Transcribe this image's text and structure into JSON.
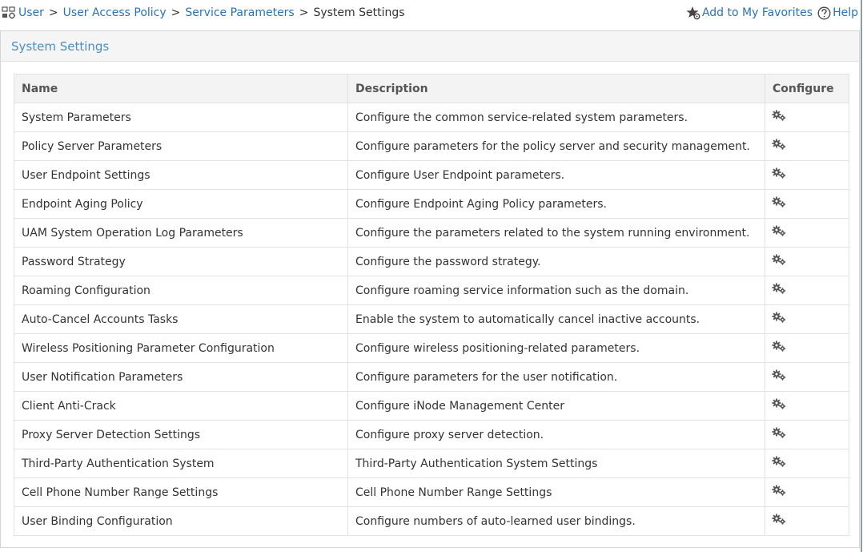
{
  "breadcrumb": {
    "items": [
      {
        "label": "User"
      },
      {
        "label": "User Access Policy"
      },
      {
        "label": "Service Parameters"
      }
    ],
    "separator": ">",
    "current": "System Settings"
  },
  "actions": {
    "favorites": "Add to My Favorites",
    "help": "Help"
  },
  "panel": {
    "title": "System Settings"
  },
  "table": {
    "columns": [
      "Name",
      "Description",
      "Configure"
    ],
    "rows": [
      {
        "name": "System Parameters",
        "description": "Configure the common service-related system parameters."
      },
      {
        "name": "Policy Server Parameters",
        "description": "Configure parameters for the policy server and security management."
      },
      {
        "name": "User Endpoint Settings",
        "description": "Configure User Endpoint parameters."
      },
      {
        "name": "Endpoint Aging Policy",
        "description": "Configure Endpoint Aging Policy parameters."
      },
      {
        "name": "UAM System Operation Log Parameters",
        "description": "Configure the parameters related to the system running environment."
      },
      {
        "name": "Password Strategy",
        "description": "Configure the password strategy."
      },
      {
        "name": "Roaming Configuration",
        "description": "Configure roaming service information such as the domain."
      },
      {
        "name": "Auto-Cancel Accounts Tasks",
        "description": "Enable the system to automatically cancel inactive accounts."
      },
      {
        "name": "Wireless Positioning Parameter Configuration",
        "description": "Configure wireless positioning-related parameters."
      },
      {
        "name": "User Notification Parameters",
        "description": "Configure parameters for the user notification."
      },
      {
        "name": "Client Anti-Crack",
        "description": "Configure iNode Management Center"
      },
      {
        "name": "Proxy Server Detection Settings",
        "description": "Configure proxy server detection."
      },
      {
        "name": "Third-Party Authentication System",
        "description": "Third-Party Authentication System Settings"
      },
      {
        "name": "Cell Phone Number Range Settings",
        "description": "Cell Phone Number Range Settings"
      },
      {
        "name": "User Binding Configuration",
        "description": "Configure numbers of auto-learned user bindings."
      }
    ]
  },
  "icons": {
    "breadcrumb": "user-group-icon",
    "favorites": "star-gear-icon",
    "help": "question-circle-icon",
    "configure": "gears-icon"
  },
  "colors": {
    "link": "#2a72b5",
    "title": "#4a8fc7",
    "border": "#e2e2e2"
  }
}
